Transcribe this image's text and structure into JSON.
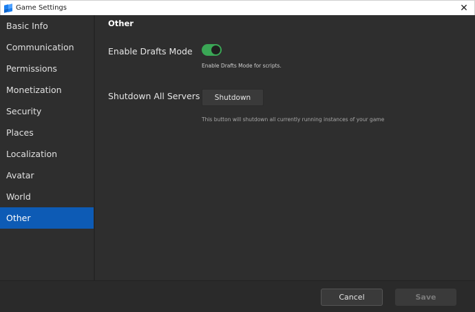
{
  "window": {
    "title": "Game Settings",
    "close_glyph": "✕"
  },
  "sidebar": {
    "items": [
      {
        "label": "Basic Info"
      },
      {
        "label": "Communication"
      },
      {
        "label": "Permissions"
      },
      {
        "label": "Monetization"
      },
      {
        "label": "Security"
      },
      {
        "label": "Places"
      },
      {
        "label": "Localization"
      },
      {
        "label": "Avatar"
      },
      {
        "label": "World"
      },
      {
        "label": "Other",
        "active": true
      }
    ]
  },
  "main": {
    "section_title": "Other",
    "drafts": {
      "label": "Enable Drafts Mode",
      "enabled": true,
      "hint": "Enable Drafts Mode for scripts."
    },
    "shutdown": {
      "label": "Shutdown All Servers",
      "button_label": "Shutdown",
      "hint": "This button will shutdown all currently running instances of your game"
    }
  },
  "footer": {
    "cancel_label": "Cancel",
    "save_label": "Save"
  },
  "colors": {
    "accent": "#0d5bb5",
    "toggle_on": "#3aa655",
    "background": "#2e2e2e"
  }
}
